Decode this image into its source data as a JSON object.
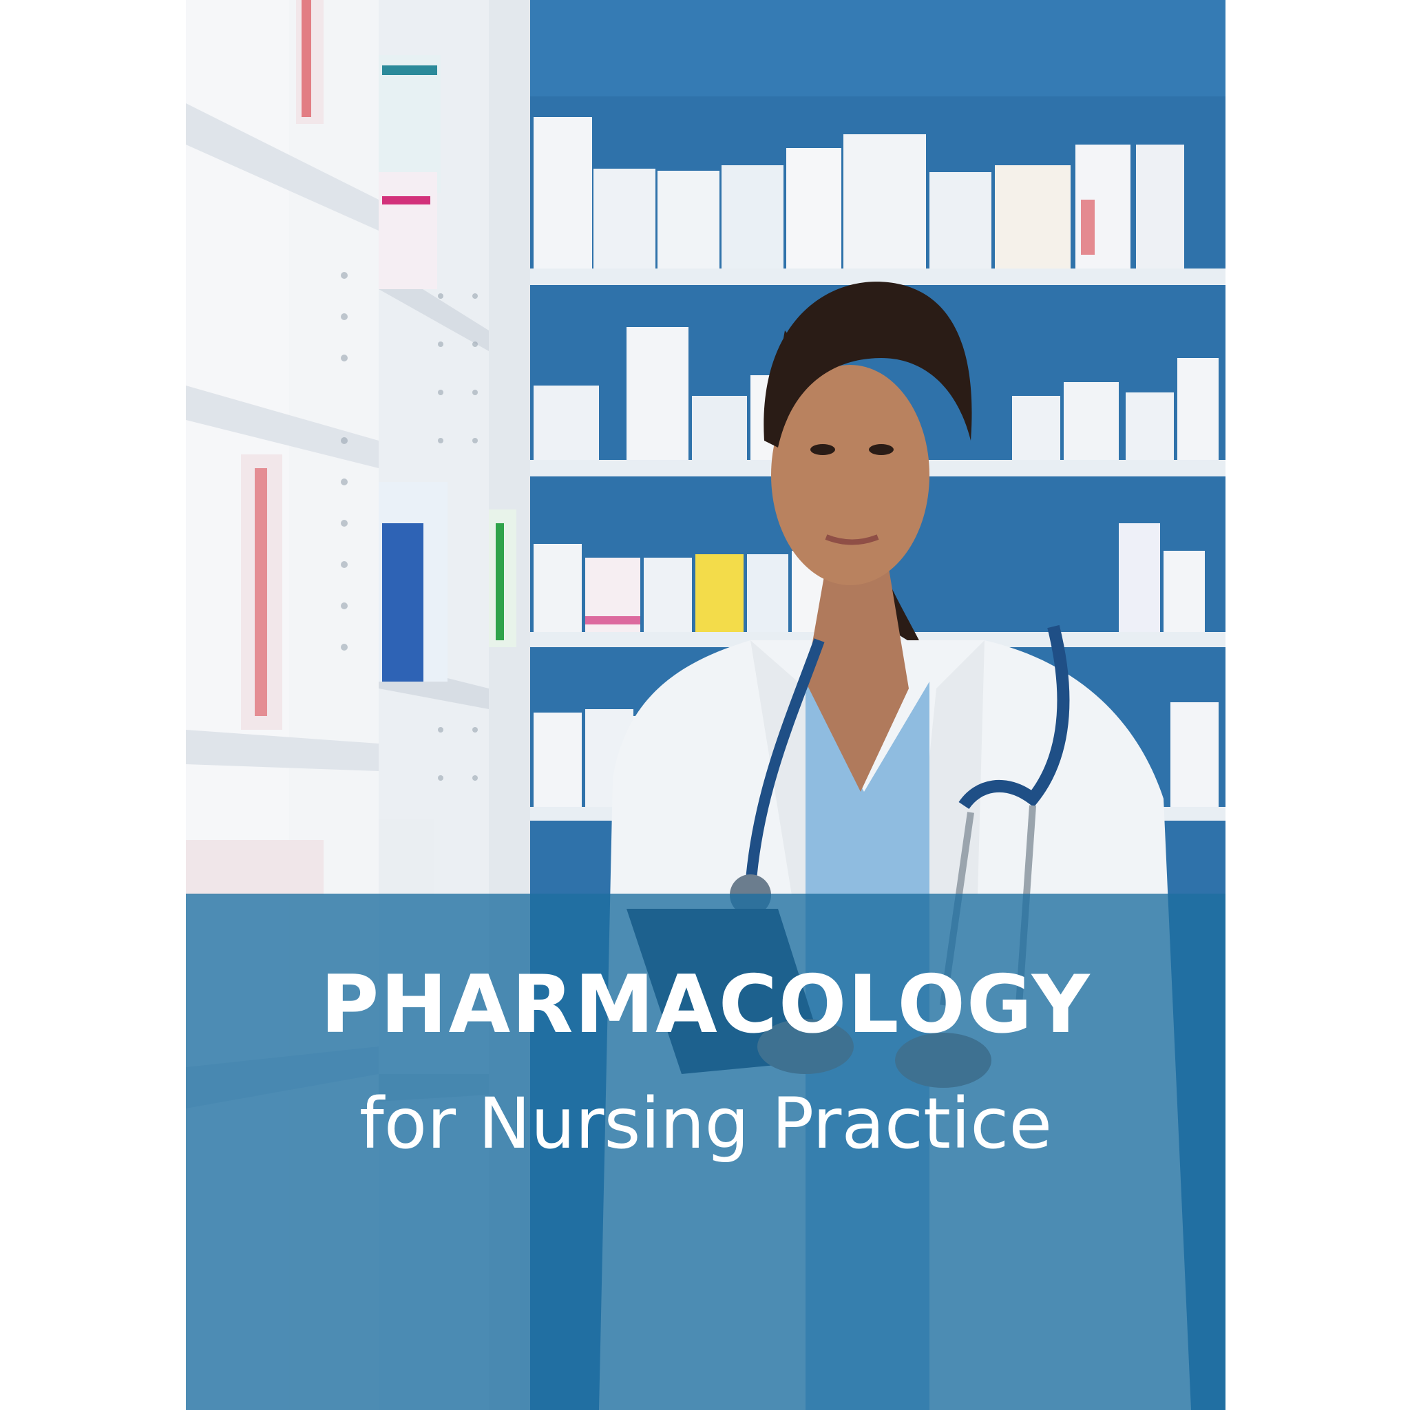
{
  "cover": {
    "title": "PHARMACOLOGY",
    "subtitle": "for Nursing Practice"
  },
  "colors": {
    "banner": "#1e6ea0",
    "wall": "#2f6fa6",
    "scrubs": "#8fbce0",
    "stethoscope": "#1f4f86",
    "coat": "#f4f6f8"
  },
  "scene": {
    "subject": "nurse-in-white-coat-with-stethoscope-holding-tablet",
    "setting": "pharmacy-shelves-with-medicine-boxes"
  }
}
